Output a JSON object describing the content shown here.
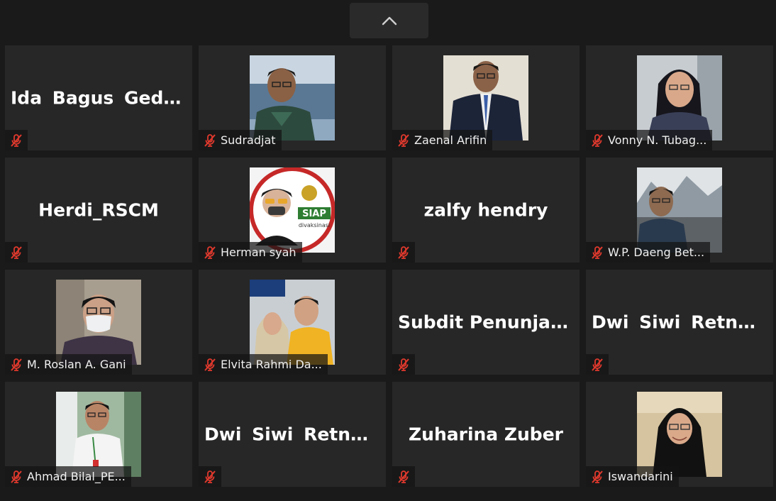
{
  "participants": [
    {
      "name": "Ida  Bagus  Gede...",
      "has_video": false
    },
    {
      "name": "Sudradjat",
      "has_video": true
    },
    {
      "name": "Zaenal Arifin",
      "has_video": true
    },
    {
      "name": "Vonny N. Tubag...",
      "has_video": true
    },
    {
      "name": "Herdi_RSCM",
      "has_video": false
    },
    {
      "name": "Herman syah",
      "has_video": true
    },
    {
      "name": "zalfy hendry",
      "has_video": false
    },
    {
      "name": "W.P. Daeng Bet...",
      "has_video": true
    },
    {
      "name": "M. Roslan A. Gani",
      "has_video": true
    },
    {
      "name": "Elvita Rahmi Da...",
      "has_video": true
    },
    {
      "name": "Subdit Penunjang",
      "has_video": false
    },
    {
      "name": "Dwi  Siwi  Retno...",
      "has_video": false
    },
    {
      "name": "Ahmad Bilal_PE...",
      "has_video": true
    },
    {
      "name": "Dwi  Siwi  Retno...",
      "has_video": false
    },
    {
      "name": "Zuharina Zuber",
      "has_video": false
    },
    {
      "name": "Iswandarini",
      "has_video": true
    }
  ],
  "photo_badge": {
    "siap_title": "SIAP",
    "siap_sub": "divaksinasi"
  },
  "colors": {
    "background": "#1a1a1a",
    "tile": "#272727",
    "muted_icon": "#e0392d",
    "text": "#ffffff"
  },
  "icons": {
    "scroll": "chevron-up-icon",
    "mute": "muted-mic-icon"
  }
}
